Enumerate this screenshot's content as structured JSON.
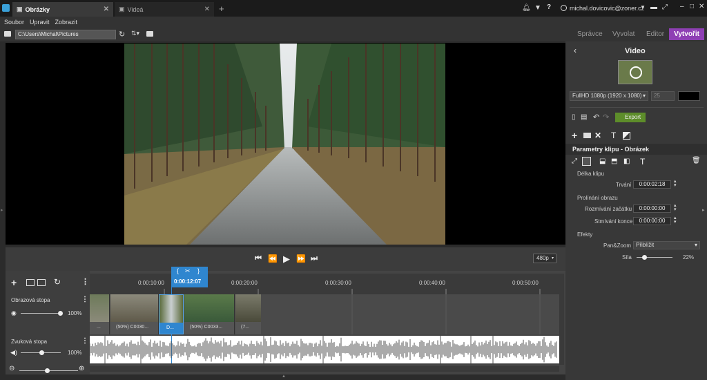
{
  "tabs": [
    {
      "label": "Obrázky"
    },
    {
      "label": "Videá"
    }
  ],
  "account": {
    "email": "michal.dovicovic@zoner.cz"
  },
  "menu": {
    "file": "Soubor",
    "edit": "Upravit",
    "view": "Zobrazit"
  },
  "path": {
    "value": "C:\\Users\\Michal\\Pictures"
  },
  "modes": {
    "manager": "Správce",
    "develop": "Vyvolat",
    "editor": "Editor",
    "create": "Vytvořit"
  },
  "panel": {
    "title": "Video",
    "resolution": "FullHD 1080p (1920 x 1080)",
    "fps": "25",
    "export": "Export",
    "clip_params": "Parametry klipu - Obrázek",
    "clip_length": "Délka klipu",
    "duration_label": "Trvání",
    "duration_value": "0:00:02:18",
    "crossfade": "Prolínání obrazu",
    "fade_in_label": "Rozmívání začátku",
    "fade_in_value": "0:00:00:00",
    "fade_out_label": "Stmívání konce",
    "fade_out_value": "0:00:00:00",
    "effects": "Efekty",
    "panzoom_label": "Pan&Zoom",
    "panzoom_value": "Přiblížit",
    "strength_label": "Síla",
    "strength_value": "22%",
    "strength_level": 0.22
  },
  "preview_quality": "480p",
  "playhead_time": "0:00:12:07",
  "ruler": [
    "0:00:10:00",
    "0:00:20:00",
    "0:00:30:00",
    "0:00:40:00",
    "0:00:50:00"
  ],
  "tracks": {
    "video_label": "Obrazová stopa",
    "video_volume": "100%",
    "audio_label": "Zvuková stopa",
    "audio_volume": "100%"
  },
  "clips": [
    {
      "label": "..."
    },
    {
      "label": "(50%) C0030..."
    },
    {
      "label": "D..."
    },
    {
      "label": "(50%) C0033..."
    },
    {
      "label": "(7..."
    }
  ]
}
